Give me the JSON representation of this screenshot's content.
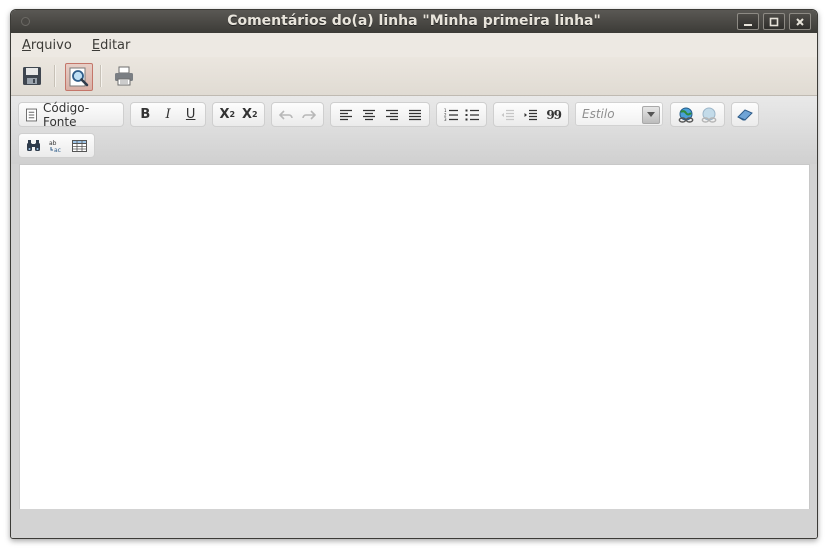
{
  "window": {
    "title": "Comentários do(a) linha \"Minha primeira linha\""
  },
  "menubar": {
    "items": [
      {
        "mnemonic": "A",
        "rest": "rquivo"
      },
      {
        "mnemonic": "E",
        "rest": "ditar"
      }
    ]
  },
  "toolbar": {
    "icons": [
      "save-icon",
      "preview-icon",
      "print-icon"
    ],
    "active": "preview-icon"
  },
  "editor_toolbar": {
    "source_label": "Código-Fonte",
    "style_placeholder": "Estilo",
    "bold_label": "B",
    "italic_label": "I",
    "underline_label": "U",
    "subscript_label": "X",
    "subscript_sup": "2",
    "superscript_label": "X",
    "superscript_sup": "2",
    "blockquote_label": "99"
  },
  "colors": {
    "titlebar": "#3c3b37",
    "menubar": "#ede9e3",
    "toolbar_active": "#c4766a",
    "editor_background": "#ffffff"
  }
}
